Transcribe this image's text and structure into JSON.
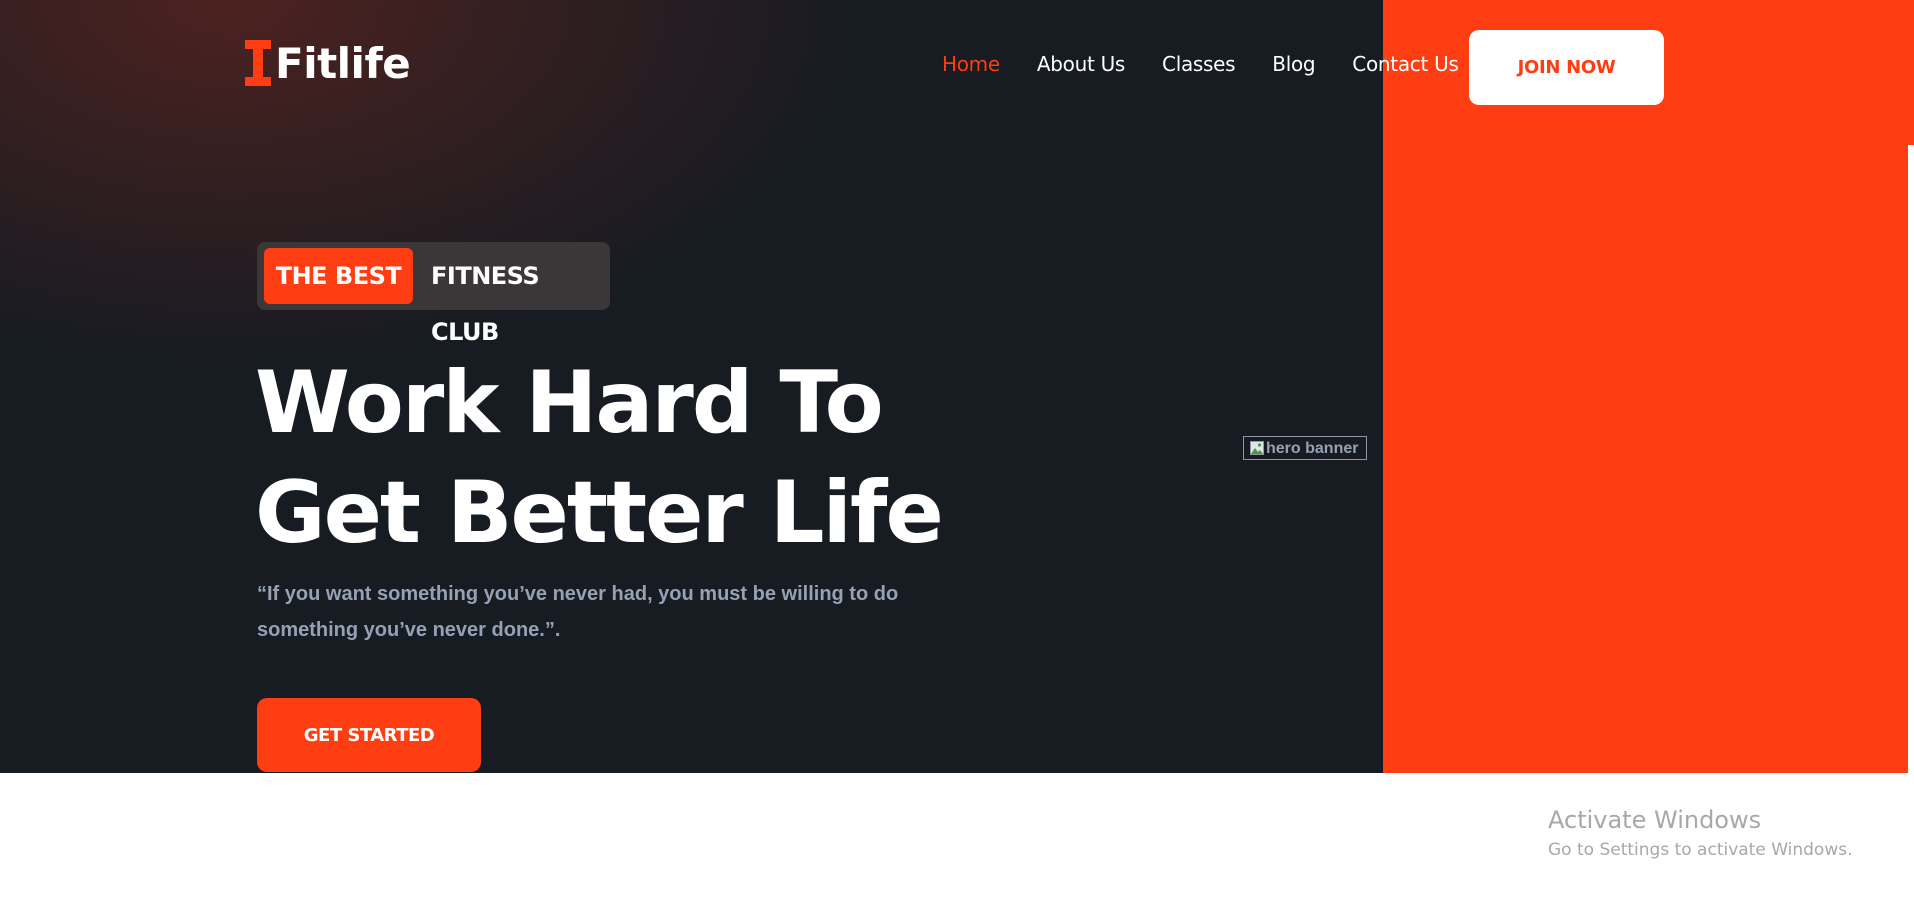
{
  "brand": {
    "name": "Fitlife",
    "icon": "dumbbell-icon",
    "accent_color": "#ff3d12"
  },
  "nav": {
    "items": [
      {
        "label": "Home",
        "active": true
      },
      {
        "label": "About Us",
        "active": false
      },
      {
        "label": "Classes",
        "active": false
      },
      {
        "label": "Blog",
        "active": false
      },
      {
        "label": "Contact Us",
        "active": false
      }
    ],
    "join_label": "JOIN NOW"
  },
  "hero": {
    "badge_highlight": "THE BEST",
    "badge_text": "FITNESS CLUB",
    "headline_line1": "Work Hard To",
    "headline_line2": "Get Better Life",
    "quote": "“If you want something you’ve never had, you must be willing to do something you’ve never done.”.",
    "cta_label": "GET STARTED",
    "banner_alt": "hero banner",
    "background_color": "#171b22",
    "panel_color": "#ff3d12"
  },
  "watermark": {
    "title": "Activate Windows",
    "subtitle": "Go to Settings to activate Windows."
  }
}
